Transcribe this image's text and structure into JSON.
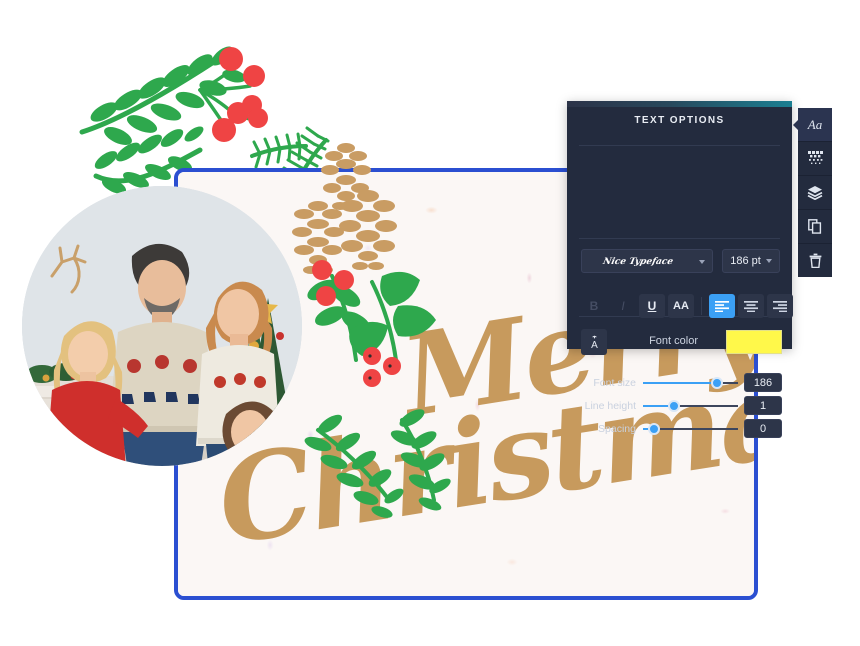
{
  "panel": {
    "title": "TEXT OPTIONS",
    "font_family_value": "Nice Typeface",
    "font_size_value": "186 pt",
    "format_buttons": [
      {
        "name": "bold",
        "label": "B",
        "state": "disabled"
      },
      {
        "name": "italic",
        "label": "I",
        "state": "disabled"
      },
      {
        "name": "underline",
        "label": "U",
        "state": "boxed"
      },
      {
        "name": "uppercase",
        "label": "AA",
        "state": "boxed"
      },
      {
        "name": "align-left",
        "label": "",
        "state": "active"
      },
      {
        "name": "align-center",
        "label": "",
        "state": "boxed"
      },
      {
        "name": "align-right",
        "label": "",
        "state": "boxed"
      }
    ],
    "text_effects_label": "A",
    "font_color_label": "Font color",
    "font_color_value": "#FFF84A",
    "sliders": [
      {
        "name": "font-size",
        "label": "Font size",
        "value": "186",
        "percent": 78
      },
      {
        "name": "line-height",
        "label": "Line height",
        "value": "1",
        "percent": 33
      },
      {
        "name": "spacing",
        "label": "Spacing",
        "value": "0",
        "percent": 12
      }
    ]
  },
  "toolbar": {
    "items": [
      {
        "name": "text-tool",
        "icon": "aa-icon",
        "selected": true
      },
      {
        "name": "transparency-tool",
        "icon": "halftone-icon",
        "selected": false
      },
      {
        "name": "layers-tool",
        "icon": "layers-icon",
        "selected": false
      },
      {
        "name": "duplicate-tool",
        "icon": "copy-icon",
        "selected": false
      },
      {
        "name": "delete-tool",
        "icon": "trash-icon",
        "selected": false
      }
    ]
  },
  "canvas": {
    "headline_line1": "Merry",
    "headline_line2": "Christmas",
    "headline_color": "#c79a5d",
    "background_color": "#fbf7f5",
    "selection_border_color": "#2b4fd1",
    "photo_alt": "family-christmas-photo"
  },
  "decorations": {
    "leaf_green": "#2ea84d",
    "berry_red": "#ef4444",
    "pinecone_gold": "#c99c63"
  }
}
